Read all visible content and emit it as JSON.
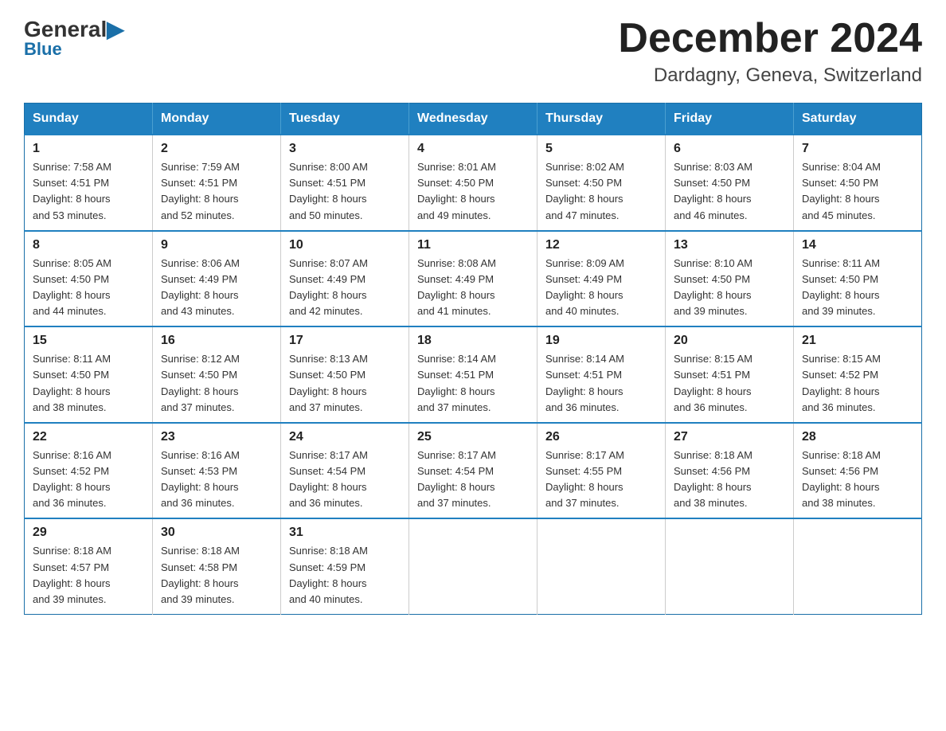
{
  "logo": {
    "general": "General",
    "blue": "Blue"
  },
  "title": {
    "month_year": "December 2024",
    "location": "Dardagny, Geneva, Switzerland"
  },
  "days_of_week": [
    "Sunday",
    "Monday",
    "Tuesday",
    "Wednesday",
    "Thursday",
    "Friday",
    "Saturday"
  ],
  "weeks": [
    [
      {
        "day": "1",
        "sunrise": "7:58 AM",
        "sunset": "4:51 PM",
        "daylight": "8 hours and 53 minutes."
      },
      {
        "day": "2",
        "sunrise": "7:59 AM",
        "sunset": "4:51 PM",
        "daylight": "8 hours and 52 minutes."
      },
      {
        "day": "3",
        "sunrise": "8:00 AM",
        "sunset": "4:51 PM",
        "daylight": "8 hours and 50 minutes."
      },
      {
        "day": "4",
        "sunrise": "8:01 AM",
        "sunset": "4:50 PM",
        "daylight": "8 hours and 49 minutes."
      },
      {
        "day": "5",
        "sunrise": "8:02 AM",
        "sunset": "4:50 PM",
        "daylight": "8 hours and 47 minutes."
      },
      {
        "day": "6",
        "sunrise": "8:03 AM",
        "sunset": "4:50 PM",
        "daylight": "8 hours and 46 minutes."
      },
      {
        "day": "7",
        "sunrise": "8:04 AM",
        "sunset": "4:50 PM",
        "daylight": "8 hours and 45 minutes."
      }
    ],
    [
      {
        "day": "8",
        "sunrise": "8:05 AM",
        "sunset": "4:50 PM",
        "daylight": "8 hours and 44 minutes."
      },
      {
        "day": "9",
        "sunrise": "8:06 AM",
        "sunset": "4:49 PM",
        "daylight": "8 hours and 43 minutes."
      },
      {
        "day": "10",
        "sunrise": "8:07 AM",
        "sunset": "4:49 PM",
        "daylight": "8 hours and 42 minutes."
      },
      {
        "day": "11",
        "sunrise": "8:08 AM",
        "sunset": "4:49 PM",
        "daylight": "8 hours and 41 minutes."
      },
      {
        "day": "12",
        "sunrise": "8:09 AM",
        "sunset": "4:49 PM",
        "daylight": "8 hours and 40 minutes."
      },
      {
        "day": "13",
        "sunrise": "8:10 AM",
        "sunset": "4:50 PM",
        "daylight": "8 hours and 39 minutes."
      },
      {
        "day": "14",
        "sunrise": "8:11 AM",
        "sunset": "4:50 PM",
        "daylight": "8 hours and 39 minutes."
      }
    ],
    [
      {
        "day": "15",
        "sunrise": "8:11 AM",
        "sunset": "4:50 PM",
        "daylight": "8 hours and 38 minutes."
      },
      {
        "day": "16",
        "sunrise": "8:12 AM",
        "sunset": "4:50 PM",
        "daylight": "8 hours and 37 minutes."
      },
      {
        "day": "17",
        "sunrise": "8:13 AM",
        "sunset": "4:50 PM",
        "daylight": "8 hours and 37 minutes."
      },
      {
        "day": "18",
        "sunrise": "8:14 AM",
        "sunset": "4:51 PM",
        "daylight": "8 hours and 37 minutes."
      },
      {
        "day": "19",
        "sunrise": "8:14 AM",
        "sunset": "4:51 PM",
        "daylight": "8 hours and 36 minutes."
      },
      {
        "day": "20",
        "sunrise": "8:15 AM",
        "sunset": "4:51 PM",
        "daylight": "8 hours and 36 minutes."
      },
      {
        "day": "21",
        "sunrise": "8:15 AM",
        "sunset": "4:52 PM",
        "daylight": "8 hours and 36 minutes."
      }
    ],
    [
      {
        "day": "22",
        "sunrise": "8:16 AM",
        "sunset": "4:52 PM",
        "daylight": "8 hours and 36 minutes."
      },
      {
        "day": "23",
        "sunrise": "8:16 AM",
        "sunset": "4:53 PM",
        "daylight": "8 hours and 36 minutes."
      },
      {
        "day": "24",
        "sunrise": "8:17 AM",
        "sunset": "4:54 PM",
        "daylight": "8 hours and 36 minutes."
      },
      {
        "day": "25",
        "sunrise": "8:17 AM",
        "sunset": "4:54 PM",
        "daylight": "8 hours and 37 minutes."
      },
      {
        "day": "26",
        "sunrise": "8:17 AM",
        "sunset": "4:55 PM",
        "daylight": "8 hours and 37 minutes."
      },
      {
        "day": "27",
        "sunrise": "8:18 AM",
        "sunset": "4:56 PM",
        "daylight": "8 hours and 38 minutes."
      },
      {
        "day": "28",
        "sunrise": "8:18 AM",
        "sunset": "4:56 PM",
        "daylight": "8 hours and 38 minutes."
      }
    ],
    [
      {
        "day": "29",
        "sunrise": "8:18 AM",
        "sunset": "4:57 PM",
        "daylight": "8 hours and 39 minutes."
      },
      {
        "day": "30",
        "sunrise": "8:18 AM",
        "sunset": "4:58 PM",
        "daylight": "8 hours and 39 minutes."
      },
      {
        "day": "31",
        "sunrise": "8:18 AM",
        "sunset": "4:59 PM",
        "daylight": "8 hours and 40 minutes."
      },
      null,
      null,
      null,
      null
    ]
  ]
}
